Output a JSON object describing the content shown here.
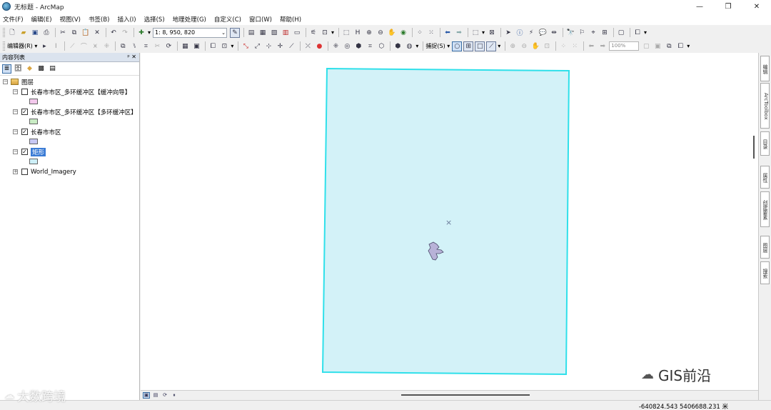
{
  "window": {
    "title": "无标题 - ArcMap",
    "minimize": "—",
    "maximize": "❐",
    "close": "✕"
  },
  "menu": [
    "文件(F)",
    "编辑(E)",
    "视图(V)",
    "书签(B)",
    "插入(I)",
    "选择(S)",
    "地理处理(G)",
    "自定义(C)",
    "窗口(W)",
    "帮助(H)"
  ],
  "toolbar": {
    "scale_value": "1: 8, 950, 820",
    "editor_label": "编辑器(R) ▾",
    "snapping_label": "捕捉(S) ▾",
    "zoom_value": "100%"
  },
  "toc": {
    "title": "内容列表",
    "pin": "ᵖ ✕",
    "root_label": "图层",
    "layers": [
      {
        "label": "长春市市区_多环缓冲区【缓冲向导】",
        "checked": false,
        "swatch": "#f3c8ec"
      },
      {
        "label": "长春市市区_多环缓冲区【多环缓冲区】",
        "checked": true,
        "swatch": "#c9ecc4"
      },
      {
        "label": "长春市市区",
        "checked": true,
        "swatch": "#c8c8f4"
      },
      {
        "label": "矩形",
        "checked": true,
        "swatch": "#cdeff7",
        "selected": true
      },
      {
        "label": "World_Imagery",
        "checked": false
      }
    ]
  },
  "map": {
    "rect_fill": "#d3f2f8",
    "rect_stroke": "#2fe0ea",
    "center_marker": "×"
  },
  "right_dock": {
    "tabs": [
      "编辑",
      "ArcToolbox",
      "目录",
      "属性",
      "创建要素",
      "图层",
      "搜索"
    ]
  },
  "status": {
    "coordinates": "-640824.543  5406688.231 米"
  },
  "watermark": {
    "left": "大数跨境",
    "right": "GIS前沿"
  }
}
